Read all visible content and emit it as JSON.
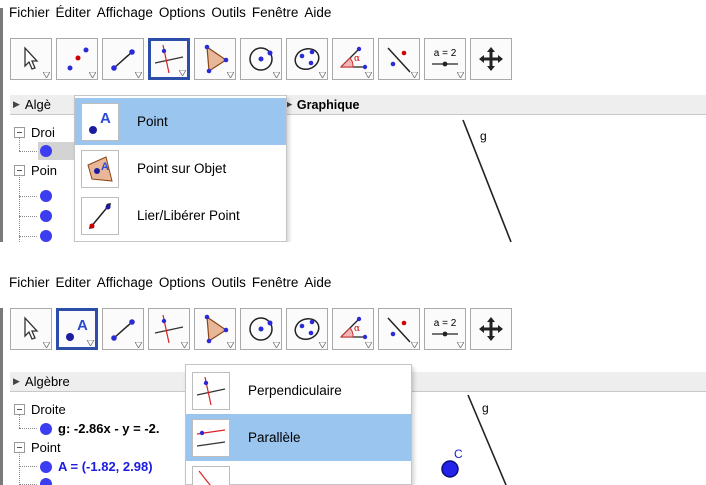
{
  "top": {
    "menu": [
      "Fichier",
      "Éditer",
      "Affichage",
      "Options",
      "Outils",
      "Fenêtre",
      "Aide"
    ],
    "algebra_title": "Algè",
    "graphics_title": "Graphique",
    "tree": {
      "group1": "Droi",
      "group2": "Poin"
    },
    "line_label": "g",
    "dropdown": [
      {
        "label": "Point",
        "icon": "point-icon",
        "selected": true
      },
      {
        "label": "Point sur Objet",
        "icon": "point-on-object-icon",
        "selected": false
      },
      {
        "label": "Lier/Libérer Point",
        "icon": "attach-detach-point-icon",
        "selected": false
      }
    ]
  },
  "bottom": {
    "menu": [
      "Fichier",
      "Editer",
      "Affichage",
      "Options",
      "Outils",
      "Fenêtre",
      "Aide"
    ],
    "algebra_title": "Algèbre",
    "tree": {
      "group1": "Droite",
      "item1": "g: -2.86x - y = -2.",
      "group2": "Point",
      "item2": "A = (-1.82, 2.98)"
    },
    "line_label": "g",
    "point_label": "C",
    "dropdown": [
      {
        "label": "Perpendiculaire",
        "icon": "perpendicular-line-icon",
        "selected": false
      },
      {
        "label": "Parallèle",
        "icon": "parallel-line-icon",
        "selected": true
      },
      {
        "label": "",
        "icon": "perpendicular-bisector-icon",
        "selected": false
      }
    ]
  },
  "toolbar": {
    "slider_label": "a = 2",
    "tools": [
      "move-icon",
      "point-icon",
      "line-icon",
      "perpendicular-line-icon",
      "polygon-icon",
      "circle-icon",
      "conic-icon",
      "angle-icon",
      "reflect-icon",
      "slider-icon",
      "move-graphics-icon"
    ]
  },
  "colors": {
    "accent_blue": "#2d4ea8",
    "selection": "#99c5ee",
    "point_fill": "#3c3cf0"
  }
}
